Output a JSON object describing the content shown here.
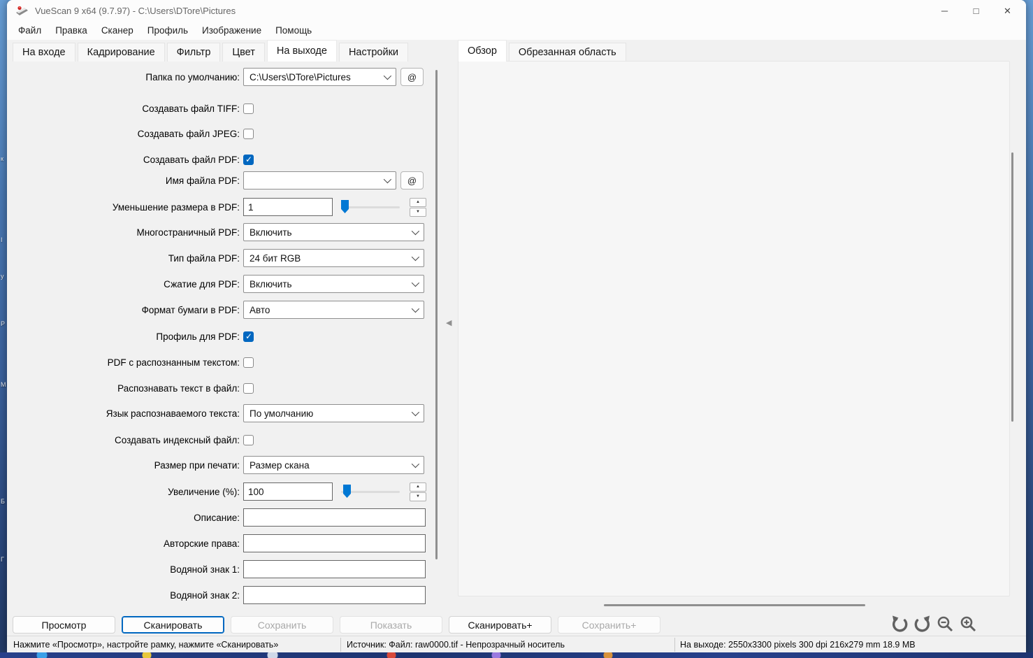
{
  "window": {
    "title": "VueScan 9 x64 (9.7.97) - C:\\Users\\DTore\\Pictures",
    "controls": {
      "minimize": "─",
      "maximize": "□",
      "close": "✕"
    }
  },
  "menu": {
    "items": [
      "Файл",
      "Правка",
      "Сканер",
      "Профиль",
      "Изображение",
      "Помощь"
    ]
  },
  "tabs": {
    "left": [
      "На входе",
      "Кадрирование",
      "Фильтр",
      "Цвет",
      "На выходе",
      "Настройки"
    ],
    "active_left": "На выходе",
    "right": [
      "Обзор",
      "Обрезанная область"
    ],
    "active_right": "Обзор"
  },
  "form": {
    "default_folder": {
      "label": "Папка по умолчанию:",
      "value": "C:\\Users\\DTore\\Pictures"
    },
    "tiff": {
      "label": "Создавать файл TIFF:",
      "checked": false
    },
    "jpeg": {
      "label": "Создавать файл JPEG:",
      "checked": false
    },
    "pdf": {
      "label": "Создавать файл PDF:",
      "checked": true
    },
    "pdf_filename": {
      "label": "Имя файла PDF:",
      "value": ""
    },
    "pdf_size_reduction": {
      "label": "Уменьшение размера в PDF:",
      "value": "1"
    },
    "multipage_pdf": {
      "label": "Многостраничный PDF:",
      "value": "Включить"
    },
    "pdf_file_type": {
      "label": "Тип файла PDF:",
      "value": "24 бит RGB"
    },
    "pdf_compression": {
      "label": "Сжатие для PDF:",
      "value": "Включить"
    },
    "pdf_paper_size": {
      "label": "Формат бумаги в PDF:",
      "value": "Авто"
    },
    "pdf_profile": {
      "label": "Профиль для PDF:",
      "checked": true
    },
    "ocr_pdf": {
      "label": "PDF с распознанным текстом:",
      "checked": false
    },
    "ocr_text_file": {
      "label": "Распознавать текст в файл:",
      "checked": false
    },
    "ocr_language": {
      "label": "Язык распознаваемого текста:",
      "value": "По умолчанию"
    },
    "index_file": {
      "label": "Создавать индексный файл:",
      "checked": false
    },
    "printed_size": {
      "label": "Размер при печати:",
      "value": "Размер скана"
    },
    "magnification": {
      "label": "Увеличение (%):",
      "value": "100"
    },
    "description": {
      "label": "Описание:",
      "value": ""
    },
    "copyright": {
      "label": "Авторские права:",
      "value": ""
    },
    "watermark1": {
      "label": "Водяной знак 1:",
      "value": ""
    },
    "watermark2": {
      "label": "Водяной знак 2:",
      "value": ""
    }
  },
  "icons": {
    "at": "@",
    "spin_up": "▲",
    "spin_down": "▼",
    "splitter_left": "◀"
  },
  "buttons": {
    "preview": {
      "label": "Просмотр",
      "disabled": false
    },
    "scan": {
      "label": "Сканировать",
      "disabled": false
    },
    "save": {
      "label": "Сохранить",
      "disabled": true
    },
    "show": {
      "label": "Показать",
      "disabled": true
    },
    "scan_plus": {
      "label": "Сканировать+",
      "disabled": false
    },
    "save_plus": {
      "label": "Сохранить+",
      "disabled": true
    }
  },
  "status": {
    "left": "Нажмите «Просмотр», настройте рамку, нажмите «Сканировать»",
    "middle": "Источник: Файл: raw0000.tif - Непрозрачный носитель",
    "right": "На выходе: 2550x3300 pixels 300 dpi 216x279 mm 18.9 MB"
  },
  "colors": {
    "accent": "#0067c0",
    "slider_thumb": "#0078d4",
    "checkbox_checked": "#0067c0"
  },
  "desktop": {
    "edge_letters": [
      "к",
      "І",
      "у",
      "Р",
      "М",
      "Б",
      "Г"
    ]
  }
}
